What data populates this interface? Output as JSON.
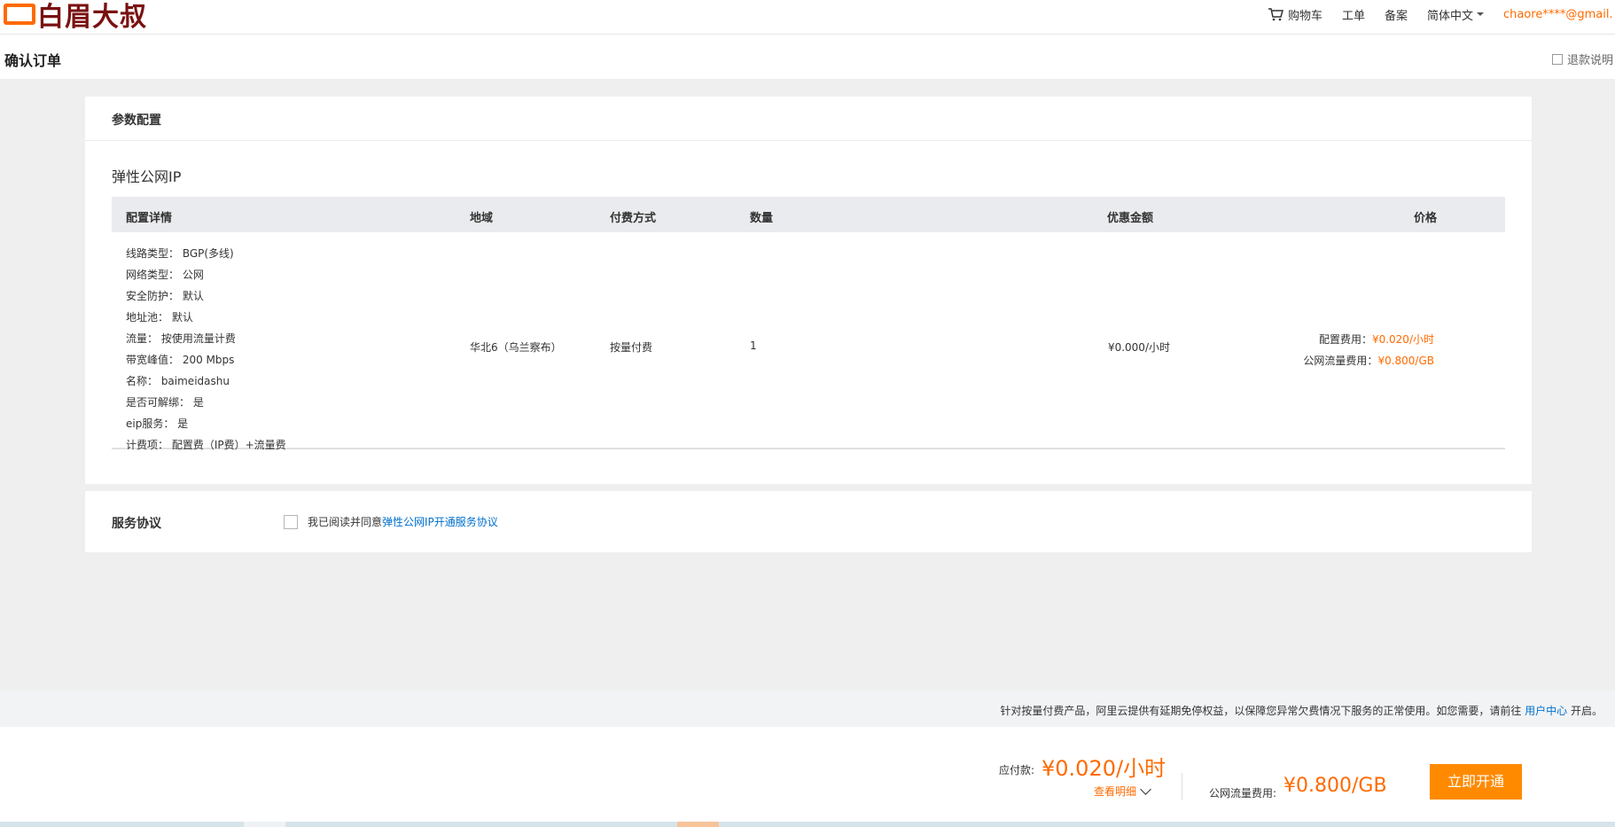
{
  "header": {
    "logo_text": "白眉大叔",
    "nav": {
      "cart": "购物车",
      "ticket": "工单",
      "beian": "备案",
      "language": "简体中文",
      "user": "chaore****@gmail.com"
    }
  },
  "title_bar": {
    "title": "确认订单",
    "refund_link": "退款说明"
  },
  "config_card": {
    "heading": "参数配置",
    "product": "弹性公网IP",
    "columns": {
      "detail": "配置详情",
      "region": "地域",
      "payment": "付费方式",
      "quantity": "数量",
      "discount": "优惠金额",
      "price": "价格"
    },
    "row": {
      "detail_lines": [
        "线路类型： BGP(多线)",
        "网络类型： 公网",
        "安全防护： 默认",
        "地址池： 默认",
        "流量： 按使用流量计费",
        "带宽峰值： 200 Mbps",
        "名称： baimeidashu",
        "是否可解绑： 是",
        "eip服务： 是",
        "计费项： 配置费（IP费）+流量费"
      ],
      "region": "华北6（乌兰察布）",
      "payment": "按量付费",
      "quantity": "1",
      "discount": "¥0.000/小时",
      "price_config_label": "配置费用：",
      "price_config_value": "¥0.020/小时",
      "price_traffic_label": "公网流量费用：",
      "price_traffic_value": "¥0.800/GB"
    }
  },
  "agreement_card": {
    "heading": "服务协议",
    "checked": false,
    "text": "我已阅读并同意",
    "link": "弹性公网IP开通服务协议"
  },
  "notice": {
    "text": "针对按量付费产品，阿里云提供有延期免停权益，以保障您异常欠费情况下服务的正常使用。如您需要，请前往 ",
    "link": "用户中心",
    "suffix": " 开启。"
  },
  "footer": {
    "pay_label": "应付款:",
    "pay_amount": "¥0.020/小时",
    "detail_link": "查看明细",
    "traffic_label": "公网流量费用:",
    "traffic_amount": "¥0.800/GB",
    "open_button": "立即开通"
  }
}
